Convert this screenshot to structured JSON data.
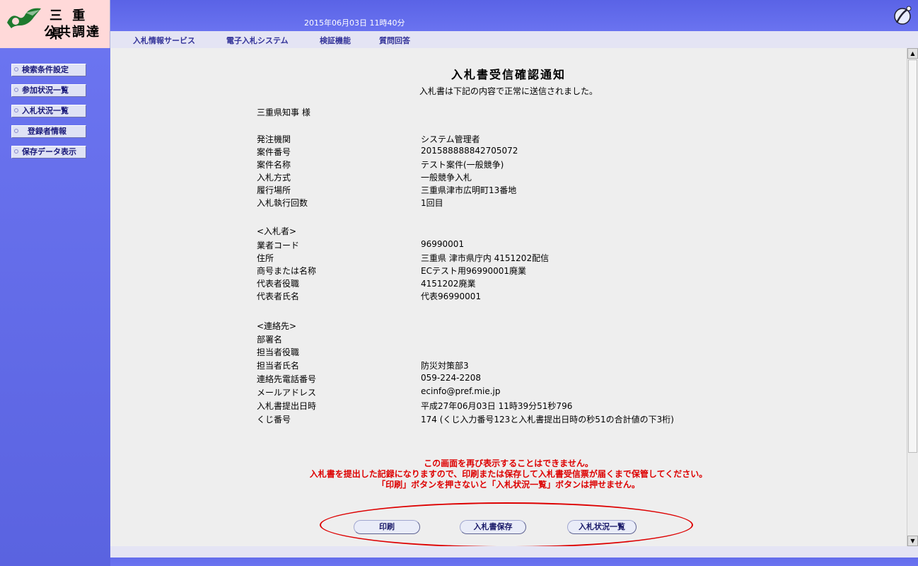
{
  "logo": {
    "line1": "三 重 県",
    "line2": "公共調達"
  },
  "header": {
    "datetime": "2015年06月03日 11時40分"
  },
  "menu": [
    "入札情報サービス",
    "電子入札システム",
    "検証機能",
    "質問回答"
  ],
  "sidebar": [
    {
      "label": "検索条件設定"
    },
    {
      "label": "参加状況一覧"
    },
    {
      "label": "入札状況一覧"
    },
    {
      "label": "登録者情報"
    },
    {
      "label": "保存データ表示"
    }
  ],
  "notice": {
    "title": "入札書受信確認通知",
    "subtitle": "入札書は下記の内容で正常に送信されました。",
    "addressee": "三重県知事 様",
    "rows": [
      {
        "label": "発注機関",
        "value": "システム管理者"
      },
      {
        "label": "案件番号",
        "value": "201588888842705072"
      },
      {
        "label": "案件名称",
        "value": "テスト案件(一般競争)"
      },
      {
        "label": "入札方式",
        "value": "一般競争入札"
      },
      {
        "label": "履行場所",
        "value": "三重県津市広明町13番地"
      },
      {
        "label": "入札執行回数",
        "value": "1回目"
      }
    ],
    "bidder_heading": "<入札者>",
    "bidder_rows": [
      {
        "label": "業者コード",
        "value": "96990001"
      },
      {
        "label": "住所",
        "value": "三重県 津市県庁内 4151202配信"
      },
      {
        "label": "商号または名称",
        "value": "ECテスト用96990001廃業"
      },
      {
        "label": "代表者役職",
        "value": "4151202廃業"
      },
      {
        "label": "代表者氏名",
        "value": "代表96990001"
      }
    ],
    "contact_heading": "<連絡先>",
    "contact_rows": [
      {
        "label": "部署名",
        "value": ""
      },
      {
        "label": "担当者役職",
        "value": ""
      },
      {
        "label": "担当者氏名",
        "value": "防災対策部3"
      },
      {
        "label": "連絡先電話番号",
        "value": "059-224-2208"
      },
      {
        "label": "メールアドレス",
        "value": "ecinfo@pref.mie.jp"
      },
      {
        "label": "入札書提出日時",
        "value": "平成27年06月03日 11時39分51秒796"
      },
      {
        "label": "くじ番号",
        "value": "174 (くじ入力番号123と入札書提出日時の秒51の合計値の下3桁)"
      }
    ],
    "warnings": [
      "この画面を再び表示することはできません。",
      "入札書を提出した記録になりますので、印刷または保存して入札書受信票が届くまで保管してください。",
      "「印刷」ボタンを押さないと「入札状況一覧」ボタンは押せません。"
    ]
  },
  "buttons": {
    "print": "印刷",
    "save": "入札書保存",
    "status_list": "入札状況一覧"
  },
  "colors": {
    "header_blue": "#5a63e6",
    "warning_red": "#dd0000",
    "logo_bg": "#ffd9d9"
  }
}
